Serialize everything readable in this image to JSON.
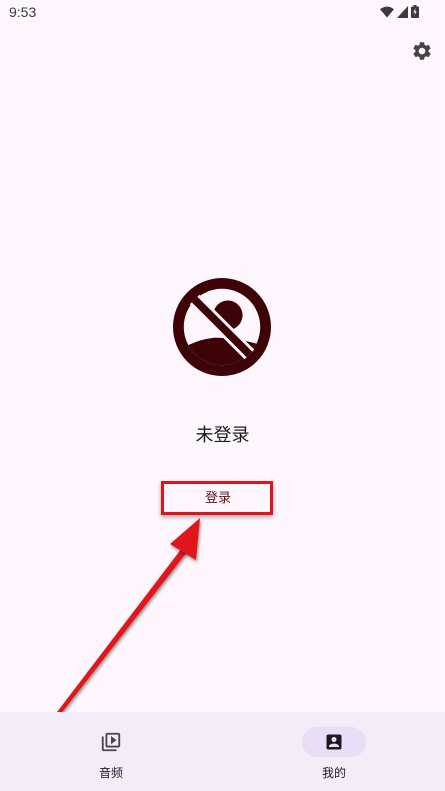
{
  "status_bar": {
    "time": "9:53"
  },
  "profile": {
    "status_text": "未登录",
    "login_label": "登录"
  },
  "bottom_nav": {
    "items": [
      {
        "label": "音频",
        "icon": "audio-library-icon",
        "selected": false
      },
      {
        "label": "我的",
        "icon": "account-box-icon",
        "selected": true
      }
    ]
  },
  "annotation": {
    "highlight_color": "#e0151b"
  },
  "colors": {
    "avatar": "#3d0306",
    "background": "#fdf7fd",
    "nav_background": "#f3edf7",
    "nav_indicator": "#e8def8"
  }
}
